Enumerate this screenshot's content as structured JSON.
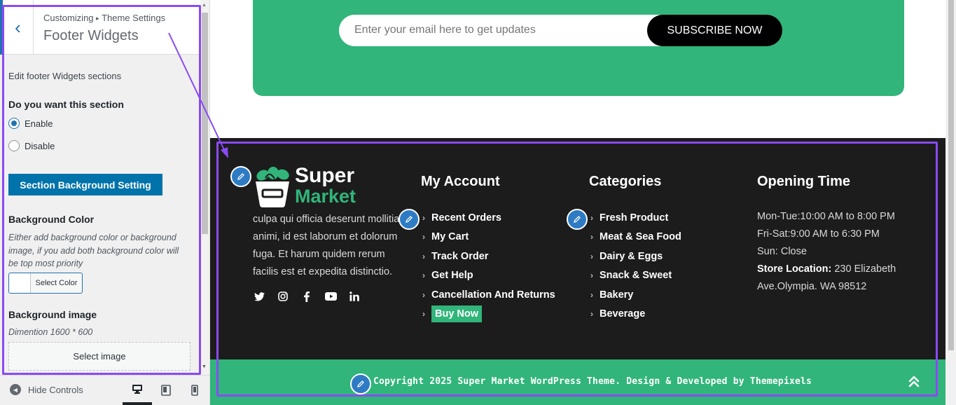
{
  "customizer": {
    "breadcrumb_root": "Customizing",
    "breadcrumb_sep": "▸",
    "breadcrumb_parent": "Theme Settings",
    "section_title": "Footer Widgets",
    "intro": "Edit footer Widgets sections",
    "toggle_label": "Do you want this section",
    "options": [
      {
        "label": "Enable",
        "selected": true
      },
      {
        "label": "Disable",
        "selected": false
      }
    ],
    "bg_setting_button": "Section Background Setting",
    "bg_color_label": "Background Color",
    "bg_color_desc": "Either add background color or background image, if you add both background color will be top most priority",
    "select_color": "Select Color",
    "bg_image_label": "Background image",
    "dimension": "Dimention 1600 * 600",
    "select_image": "Select image",
    "hide_controls": "Hide Controls",
    "devices": [
      "desktop",
      "tablet",
      "mobile"
    ],
    "active_device": "desktop"
  },
  "preview": {
    "newsletter": {
      "placeholder": "Enter your email here to get updates",
      "button": "SUBSCRIBE NOW"
    },
    "footer": {
      "logo_top": "Super",
      "logo_bottom": "Market",
      "about_lines": [
        "culpa qui officia deserunt mollitia",
        "animi, id est laborum et dolorum",
        "fuga. Et harum quidem rerum",
        "facilis est et expedita distinctio."
      ],
      "social_icons": [
        "twitter-icon",
        "instagram-icon",
        "facebook-icon",
        "youtube-icon",
        "linkedin-icon"
      ],
      "account": {
        "title": "My Account",
        "items": [
          "Recent Orders",
          "My Cart",
          "Track Order",
          "Get Help",
          "Cancellation And Returns",
          "Buy Now"
        ]
      },
      "categories": {
        "title": "Categories",
        "items": [
          "Fresh Product",
          "Meat & Sea Food",
          "Dairy & Eggs",
          "Snack & Sweet",
          "Bakery",
          "Beverage"
        ]
      },
      "opening": {
        "title": "Opening Time",
        "lines": [
          "Mon-Tue:10:00 AM to 8:00 PM",
          "Fri-Sat:9:00 AM to 6:30 PM",
          "Sun: Close"
        ],
        "store_label": "Store Location:",
        "store_value_1": " 230 Elizabeth",
        "store_value_2": "Ave.Olympia. WA 98512"
      },
      "copyright": "Copyright 2025 Super Market WordPress Theme. Design & Developed by Themepixels"
    }
  },
  "colors": {
    "brand_green": "#31b57a",
    "highlight_purple": "#8a4af3",
    "wp_blue": "#0073aa",
    "footer_bg": "#1c1c1c"
  }
}
